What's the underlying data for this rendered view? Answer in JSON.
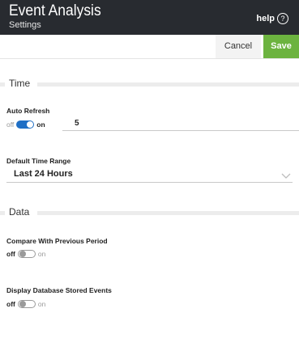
{
  "header": {
    "title": "Event Analysis",
    "subtitle": "Settings",
    "help_label": "help",
    "help_icon": "?"
  },
  "toolbar": {
    "cancel_label": "Cancel",
    "save_label": "Save"
  },
  "sections": {
    "time": {
      "label": "Time",
      "auto_refresh": {
        "label": "Auto Refresh",
        "off_label": "off",
        "on_label": "on",
        "enabled": true,
        "value": "5"
      },
      "default_time_range": {
        "label": "Default Time Range",
        "selected": "Last 24 Hours"
      }
    },
    "data": {
      "label": "Data",
      "compare_previous": {
        "label": "Compare With Previous Period",
        "off_label": "off",
        "on_label": "on",
        "enabled": false
      },
      "db_stored_events": {
        "label": "Display Database Stored Events",
        "off_label": "off",
        "on_label": "on",
        "enabled": false
      }
    }
  },
  "colors": {
    "header_bg": "#282b30",
    "save_bg": "#6cb33f",
    "toggle_on": "#1f6fc5"
  }
}
